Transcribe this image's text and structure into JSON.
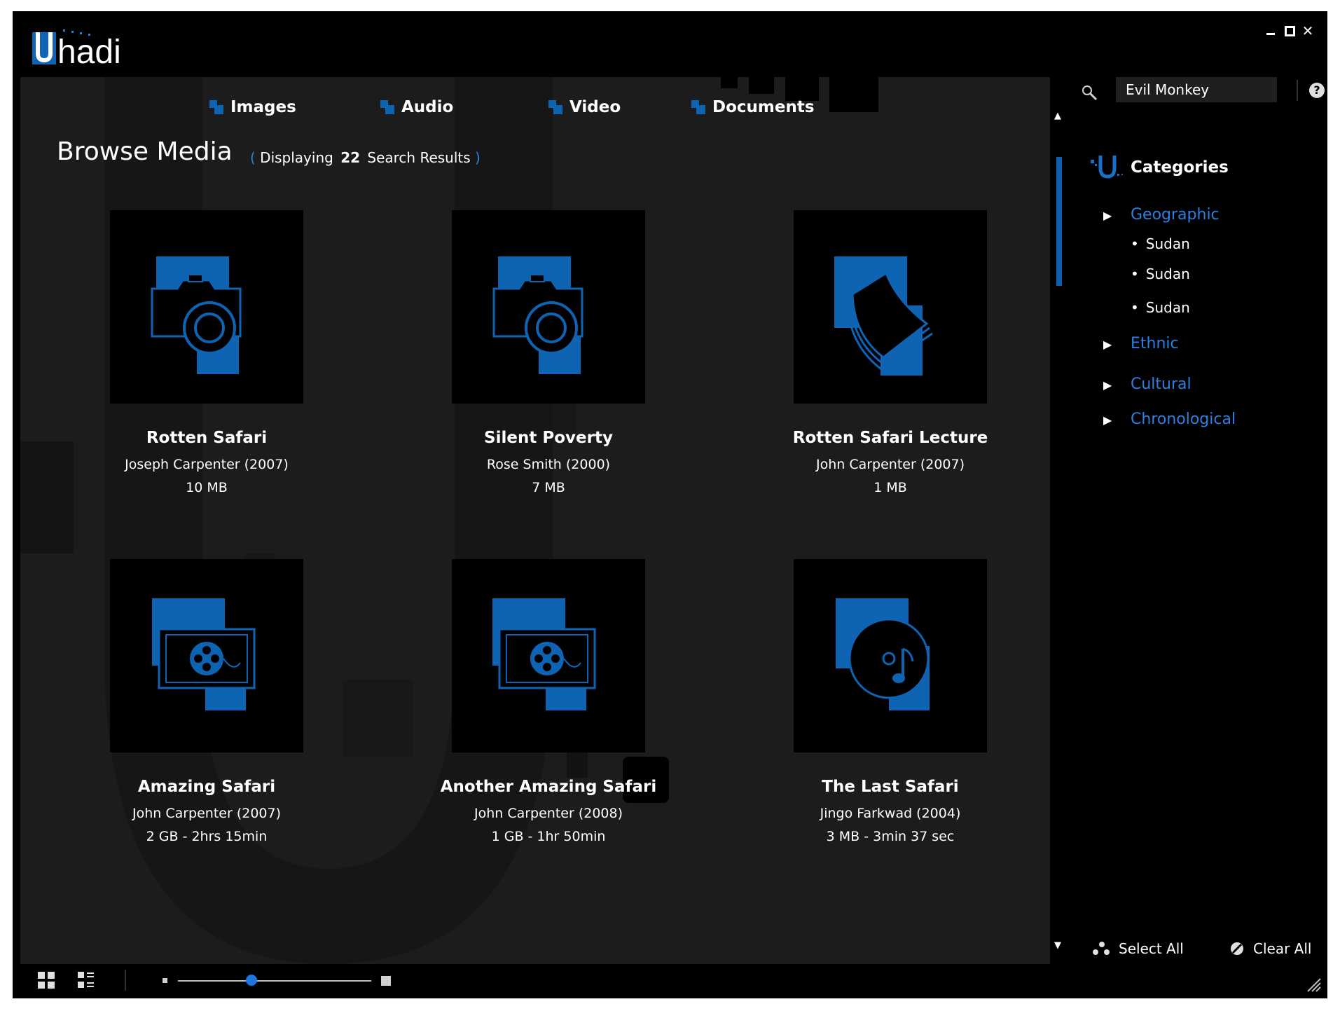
{
  "app": {
    "logo_text": "Uhadi"
  },
  "tabs": [
    {
      "label": "Images"
    },
    {
      "label": "Audio"
    },
    {
      "label": "Video"
    },
    {
      "label": "Documents"
    }
  ],
  "browse": {
    "title": "Browse Media",
    "results_prefix": "Displaying",
    "results_count": "22",
    "results_suffix": "Search Results"
  },
  "media": [
    {
      "title": "Rotten Safari",
      "author": "Joseph Carpenter (2007)",
      "size": "10 MB",
      "icon": "camera-icon"
    },
    {
      "title": "Silent Poverty",
      "author": "Rose Smith (2000)",
      "size": "7 MB",
      "icon": "camera-icon"
    },
    {
      "title": "Rotten Safari Lecture",
      "author": "John Carpenter (2007)",
      "size": "1 MB",
      "icon": "document-icon"
    },
    {
      "title": "Amazing Safari",
      "author": "John Carpenter (2007)",
      "size": "2 GB  -  2hrs 15min",
      "icon": "film-reel-icon"
    },
    {
      "title": "Another Amazing Safari",
      "author": "John Carpenter (2008)",
      "size": "1 GB  -  1hr 50min",
      "icon": "film-reel-icon"
    },
    {
      "title": "The Last Safari",
      "author": "Jingo Farkwad (2004)",
      "size": "3 MB  -  3min 37 sec",
      "icon": "music-disc-icon"
    }
  ],
  "search": {
    "value": "Evil Monkey",
    "placeholder": ""
  },
  "categories": {
    "title": "Categories",
    "geographic": {
      "label": "Geographic",
      "items": [
        "Sudan",
        "Sudan",
        "Sudan"
      ]
    },
    "ethnic": {
      "label": "Ethnic"
    },
    "cultural": {
      "label": "Cultural"
    },
    "chronological": {
      "label": "Chronological"
    }
  },
  "actions": {
    "select_all": "Select All",
    "clear_all": "Clear All"
  },
  "zoom": {
    "level": 0.38
  },
  "colors": {
    "accent": "#0f63b3",
    "link": "#2d7fe0",
    "panel": "#1c1c1c",
    "bg": "#000000"
  }
}
